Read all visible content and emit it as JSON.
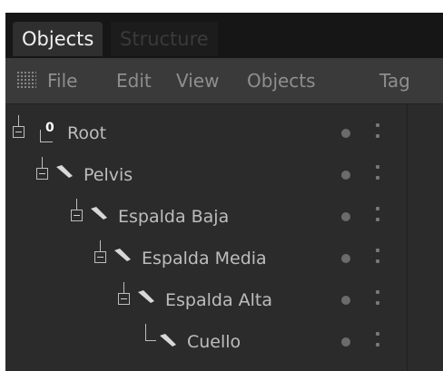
{
  "tabs": [
    {
      "label": "Objects",
      "active": true
    },
    {
      "label": "Structure",
      "active": false
    }
  ],
  "menu": [
    "File",
    "Edit",
    "View",
    "Objects",
    "Tag"
  ],
  "objects": [
    {
      "name": "Root",
      "icon": "null-icon"
    },
    {
      "name": "Pelvis",
      "icon": "bone-icon"
    },
    {
      "name": "Espalda  Baja",
      "icon": "bone-icon"
    },
    {
      "name": "Espalda Media",
      "icon": "bone-icon"
    },
    {
      "name": "Espalda Alta",
      "icon": "bone-icon"
    },
    {
      "name": "Cuello",
      "icon": "bone-icon"
    }
  ],
  "root_null_glyph": "0",
  "colors": {
    "panel": "#2a2a2a",
    "tabbar": "#161616",
    "menubar": "#3a3a3a",
    "text": "#bdbdbd"
  }
}
